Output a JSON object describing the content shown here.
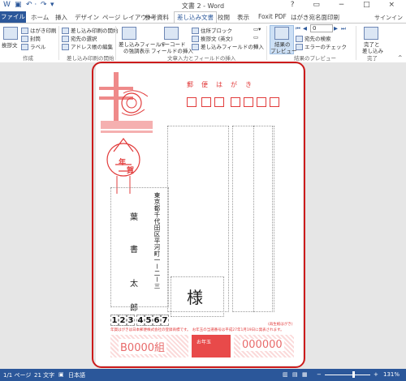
{
  "titlebar": {
    "title": "文書 2 - Word",
    "win_controls": "? ▭ − □ ×"
  },
  "qat": {
    "save_icon": "save-icon",
    "undo": "↶ ·",
    "redo": "↷",
    "customize": "▾"
  },
  "tabs": {
    "file": "ファイル",
    "home": "ホーム",
    "insert": "挿入",
    "design": "デザイン",
    "layout": "ページ レイアウト",
    "references": "参考資料",
    "mailings": "差し込み文書",
    "review": "校閲",
    "view": "表示",
    "foxit": "Foxit PDF",
    "hagaki": "はがき宛名面印刷",
    "signin": "サインイン"
  },
  "ribbon": {
    "create": {
      "greeting": "挨拶文",
      "postcard": "はがき印刷",
      "envelope": "封筒",
      "label": "ラベル",
      "group": "作成"
    },
    "start": {
      "start_merge": "差し込み印刷の開始",
      "select_recipients": "宛先の選択",
      "edit_list": "アドレス帳の編集",
      "group": "差し込み印刷の開始"
    },
    "fields": {
      "highlight": "差し込みフィールド",
      "highlight2": "の強調表示",
      "barcode": "バーコード",
      "barcode2": "フィールドの挿入",
      "address_block": "住所ブロック",
      "greeting_line": "挨拶文 (英文)",
      "insert_field": "差し込みフィールドの挿入",
      "group": "文章入力とフィールドの挿入"
    },
    "preview": {
      "button": "結果の",
      "button2": "プレビュー",
      "record": "0",
      "find": "宛先の検索",
      "check": "エラーのチェック",
      "group": "結果のプレビュー"
    },
    "finish": {
      "button": "完了と",
      "button2": "差し込み",
      "group": "完了"
    }
  },
  "postcard": {
    "header": "郵　便　は　が　き",
    "address": "東京都千代田区平河町一ー二ー三",
    "name_given": "葉",
    "name_mid": "書",
    "name_last": "太",
    "name_end": "郎",
    "honorific": "様",
    "zip_digits": [
      "1",
      "2",
      "3",
      "4",
      "5",
      "6",
      "7"
    ],
    "small_note": "(再生紙はがき)",
    "footer_red": "年賀はがきは日本郵便株式会社の登録商標です。　お年玉の当選番号は平成27年1月19日に発表されます。",
    "lottery_left": "B0000組",
    "lottery_right": "000000",
    "kanji_nen": "年",
    "kanji_ga": "賀",
    "stamp_word": "お年玉"
  },
  "status": {
    "page": "1/1 ページ",
    "words": "21 文字",
    "lang": "日本語",
    "zoom": "131%"
  }
}
